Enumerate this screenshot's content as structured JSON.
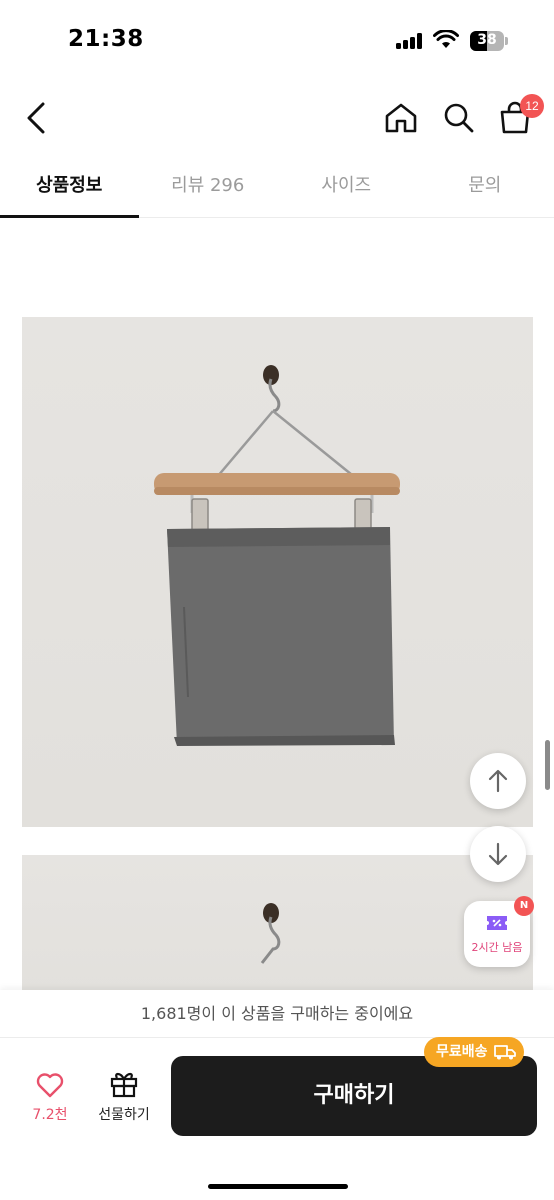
{
  "status_bar": {
    "time": "21:38",
    "battery": "38"
  },
  "header": {
    "cart_count": "12"
  },
  "tabs": [
    {
      "label": "상품정보",
      "active": true
    },
    {
      "label": "리뷰 296",
      "active": false
    },
    {
      "label": "사이즈",
      "active": false
    },
    {
      "label": "문의",
      "active": false
    }
  ],
  "floating": {
    "coupon_label": "2시간 남음",
    "coupon_badge": "N"
  },
  "bottom_bar": {
    "notice": "1,681명이 이 상품을 구매하는 중이에요",
    "like_count": "7.2천",
    "gift_label": "선물하기",
    "buy_label": "구매하기",
    "shipping_badge": "무료배송"
  },
  "colors": {
    "accent_pink": "#e8506b",
    "badge_red": "#f25454",
    "shipping_orange": "#f6a623",
    "buy_button": "#1c1c1c"
  }
}
